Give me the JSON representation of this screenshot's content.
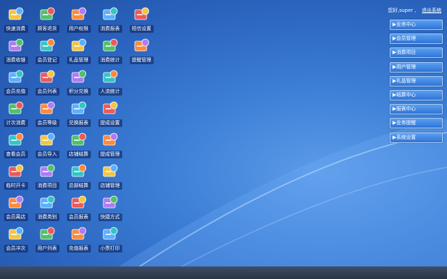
{
  "header": {
    "greeting": "您好,super ,",
    "logout": "退出系统"
  },
  "desktop_icons": [
    {
      "label": "快速消费",
      "icon": "shop-card-icon"
    },
    {
      "label": "顾客退货",
      "icon": "return-arrow-icon"
    },
    {
      "label": "用户权限",
      "icon": "user-lock-icon"
    },
    {
      "label": "消费报表",
      "icon": "report-chart-icon"
    },
    {
      "label": "短信设置",
      "icon": "mail-gear-icon"
    },
    {
      "label": "消费收银",
      "icon": "cashier-icon"
    },
    {
      "label": "会员登记",
      "icon": "member-register-icon"
    },
    {
      "label": "礼品管理",
      "icon": "gift-icon"
    },
    {
      "label": "消费统计",
      "icon": "stats-icon"
    },
    {
      "label": "提醒管理",
      "icon": "monitor-clock-icon"
    },
    {
      "label": "会员充值",
      "icon": "coins-icon"
    },
    {
      "label": "会员列表",
      "icon": "member-list-icon"
    },
    {
      "label": "积分兑换",
      "icon": "points-exchange-icon"
    },
    {
      "label": "人流统计",
      "icon": "people-icon"
    },
    {
      "label": "",
      "icon": ""
    },
    {
      "label": "计次消费",
      "icon": "count-consume-icon"
    },
    {
      "label": "会员等级",
      "icon": "member-level-icon"
    },
    {
      "label": "兑换报表",
      "icon": "exchange-report-icon"
    },
    {
      "label": "提成设置",
      "icon": "database-icon"
    },
    {
      "label": "",
      "icon": ""
    },
    {
      "label": "查看会员",
      "icon": "view-member-icon"
    },
    {
      "label": "会员导入",
      "icon": "member-import-icon"
    },
    {
      "label": "店铺结算",
      "icon": "store-settle-icon"
    },
    {
      "label": "提成管理",
      "icon": "person-icon"
    },
    {
      "label": "",
      "icon": ""
    },
    {
      "label": "临时开卡",
      "icon": "temp-card-icon"
    },
    {
      "label": "消费项目",
      "icon": "box-icon"
    },
    {
      "label": "总部结算",
      "icon": "hq-settle-icon"
    },
    {
      "label": "店铺管理",
      "icon": "store-manage-icon"
    },
    {
      "label": "",
      "icon": ""
    },
    {
      "label": "会员离店",
      "icon": "member-leave-icon"
    },
    {
      "label": "消费类别",
      "icon": "category-tree-icon"
    },
    {
      "label": "会员报表",
      "icon": "member-report-icon"
    },
    {
      "label": "快捷方式",
      "icon": "shortcut-icon"
    },
    {
      "label": "",
      "icon": ""
    },
    {
      "label": "会员冲次",
      "icon": "calculator-icon"
    },
    {
      "label": "用户列表",
      "icon": "user-list-icon"
    },
    {
      "label": "充值报表",
      "icon": "recharge-report-icon"
    },
    {
      "label": "小票打印",
      "icon": "printer-icon"
    }
  ],
  "menu": [
    "▶业务中心",
    "▶会员管理",
    "▶消费项目",
    "▶用户管理",
    "▶礼品管理",
    "▶结算中心",
    "▶报表中心",
    "▶业务提醒",
    "▶系统设置"
  ],
  "colors": {
    "accent": "#2f74d6",
    "background": "#3c7fd6",
    "taskbar": "#2a3444"
  }
}
